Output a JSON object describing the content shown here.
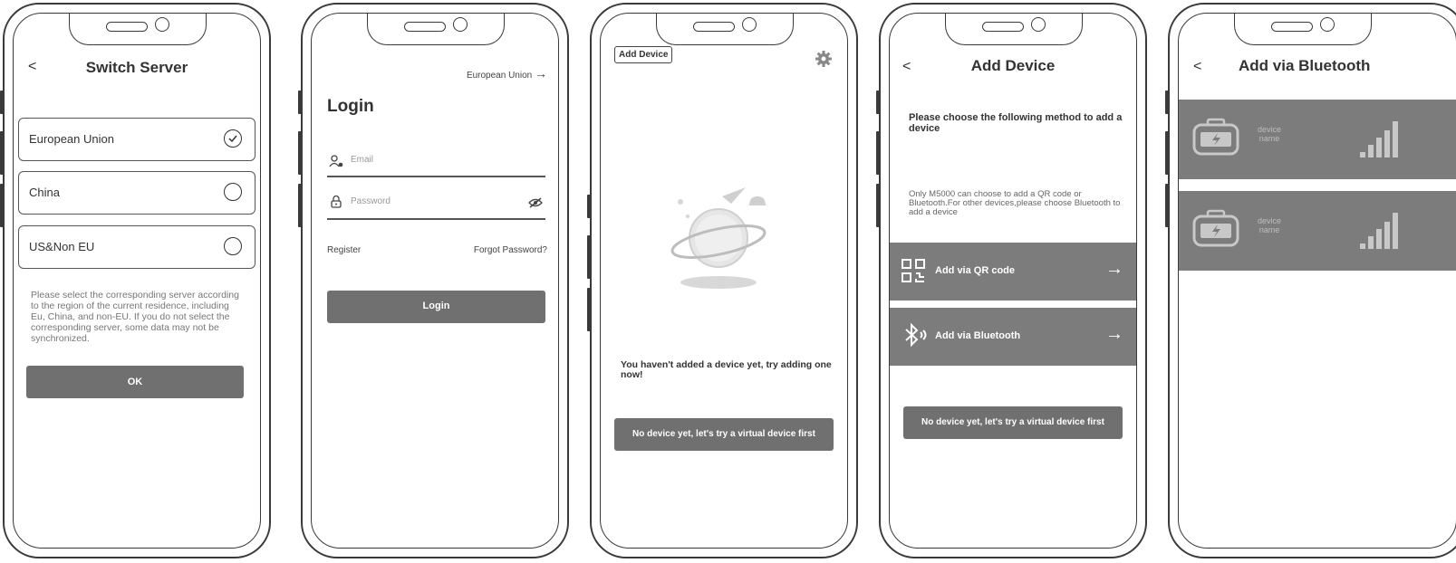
{
  "screens": {
    "switch_server": {
      "back": "<",
      "title": "Switch Server",
      "options": [
        {
          "label": "European Union",
          "selected": true
        },
        {
          "label": "China",
          "selected": false
        },
        {
          "label": "US&Non EU",
          "selected": false
        }
      ],
      "note": "Please select the corresponding server according to the region of the current residence, including Eu, China, and non-EU. If you do not select the corresponding server, some data may not be synchronized.",
      "ok_label": "OK"
    },
    "login": {
      "region": "European Union",
      "region_arrow": "→",
      "title": "Login",
      "email_placeholder": "Email",
      "password_placeholder": "Password",
      "register": "Register",
      "forgot": "Forgot Password?",
      "login_button": "Login"
    },
    "home": {
      "add_device": "Add Device",
      "empty_message": "You haven't added a device yet, try adding one now!",
      "virtual_button": "No device yet, let's try a virtual device first"
    },
    "add_device": {
      "back": "<",
      "title": "Add Device",
      "heading": "Please choose the following method to add a device",
      "note": "Only M5000 can choose to add a QR code or Bluetooth.For other devices,please choose Bluetooth to add a device",
      "qr_label": "Add via QR code",
      "bt_label": "Add via Bluetooth",
      "arrow": "→",
      "virtual_button": "No device yet, let's try a virtual device first"
    },
    "bluetooth": {
      "back": "<",
      "title": "Add via Bluetooth",
      "devices": [
        {
          "name": "device name"
        },
        {
          "name": "device name"
        }
      ]
    }
  },
  "icons": {
    "check": "checkmark-icon",
    "user": "user-icon",
    "lock": "lock-icon",
    "eye_off": "eye-off-icon",
    "gear": "gear-icon",
    "planet": "planet-illustration",
    "qr": "qr-code-icon",
    "bluetooth": "bluetooth-icon",
    "battery": "battery-station-icon",
    "signal": "signal-strength-icon"
  },
  "colors": {
    "button_gray": "#707070",
    "card_gray": "#7c7c7c",
    "outline": "#3a3a3a"
  }
}
